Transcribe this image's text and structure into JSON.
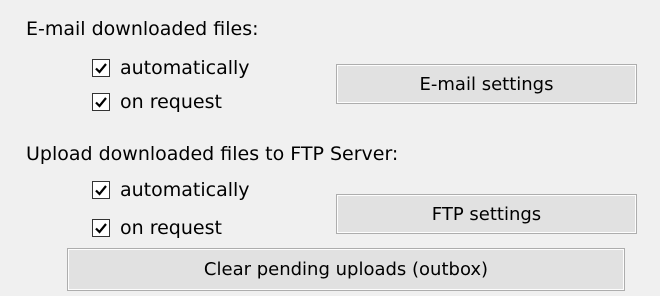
{
  "email": {
    "heading": "E-mail downloaded files:",
    "automatically": {
      "label": "automatically",
      "checked": true
    },
    "on_request": {
      "label": "on request",
      "checked": true
    },
    "settings_button": "E-mail settings"
  },
  "ftp": {
    "heading": "Upload downloaded files to FTP Server:",
    "automatically": {
      "label": "automatically",
      "checked": true
    },
    "on_request": {
      "label": "on request",
      "checked": true
    },
    "settings_button": "FTP settings"
  },
  "clear_button": "Clear pending uploads (outbox)",
  "icons": {
    "checkmark": "check-icon"
  }
}
